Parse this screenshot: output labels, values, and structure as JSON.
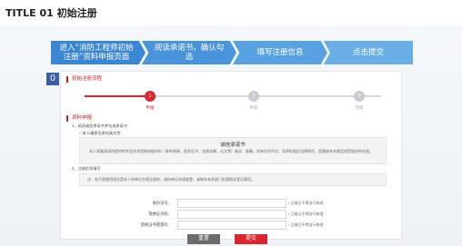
{
  "title": "TITLE 01 初始注册",
  "badge": "0",
  "steps": [
    {
      "label": "进入“消防工程师初始注册”资料申报页面"
    },
    {
      "label": "阅读承诺书，确认勾选"
    },
    {
      "label": "填写注册信息"
    },
    {
      "label": "点击提交"
    }
  ],
  "progress": {
    "section_title": "初始注册流程",
    "nodes": [
      {
        "num": "1",
        "label": "申报"
      },
      {
        "num": "2",
        "label": "审核"
      },
      {
        "num": "3",
        "label": "完成"
      }
    ]
  },
  "declare": {
    "section_title": "资料申报",
    "step1": "1、阅读诚信承诺书并勾选承诺书",
    "checkbox_label": "□ 本人确保信息的真实性",
    "box_title": "诚信承诺书",
    "box_text": "本人郑重承诺所提供的专业技术资格申报材料（各种表格、相关证书、业绩成果、论文等）真实、准确，如有任何不实，愿承担相应法律责任，愿意按有关规定接受相应的处理。",
    "step2": "2、注册信息填写",
    "notice": "注：若不是使用现在是本人的单位办理注册的，请向单位申请变更，或联系有关部门处理相关登记事项。"
  },
  "form": {
    "fields": [
      {
        "label": "身份证号：",
        "hint": "• 注册后不得自行修改"
      },
      {
        "label": "资格证号码：",
        "hint": "• 注册后不得自行修改"
      },
      {
        "label": "资格证书管理号：",
        "hint": "• 注册后不得自行修改"
      }
    ],
    "reset": "重置",
    "submit": "提交"
  }
}
